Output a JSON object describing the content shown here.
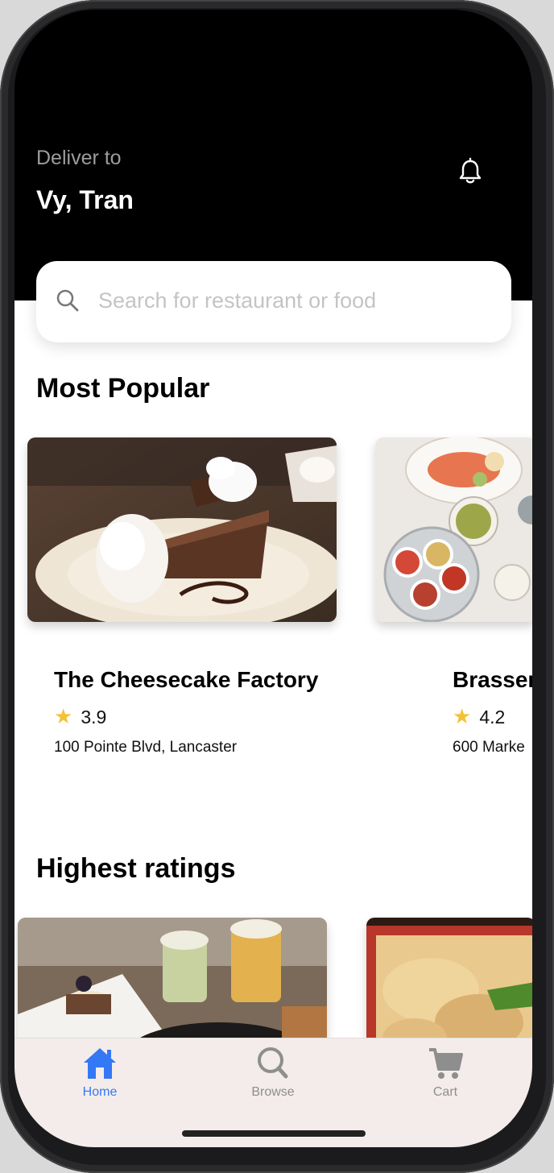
{
  "header": {
    "deliver_label": "Deliver to",
    "deliver_name": "Vy, Tran",
    "bell_icon": "bell-icon"
  },
  "search": {
    "placeholder": "Search for restaurant or food",
    "icon": "search-icon"
  },
  "sections": {
    "popular_title": "Most Popular",
    "ratings_title": "Highest ratings"
  },
  "popular": [
    {
      "name": "The Cheesecake Factory",
      "rating": "3.9",
      "address": "100 Pointe Blvd, Lancaster"
    },
    {
      "name": "Brasser",
      "rating": "4.2",
      "address": "600 Marke"
    }
  ],
  "tabs": [
    {
      "label": "Home",
      "icon": "home-icon",
      "active": true
    },
    {
      "label": "Browse",
      "icon": "search-icon",
      "active": false
    },
    {
      "label": "Cart",
      "icon": "cart-icon",
      "active": false
    }
  ],
  "colors": {
    "accent": "#3478f6",
    "inactive": "#8e8e8e",
    "star": "#f5c136"
  }
}
